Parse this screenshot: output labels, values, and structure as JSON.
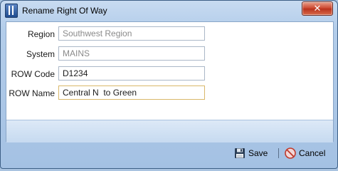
{
  "window": {
    "title": "Rename Right Of Way",
    "close_glyph": "✕",
    "icon": "app-icon"
  },
  "form": {
    "fields": [
      {
        "label": "Region",
        "value": "Southwest Region",
        "readonly": true
      },
      {
        "label": "System",
        "value": "MAINS",
        "readonly": true
      },
      {
        "label": "ROW Code",
        "value": "D1234",
        "readonly": false
      },
      {
        "label": "ROW Name",
        "value": "Central N  to Green",
        "readonly": false
      }
    ]
  },
  "toolbar": {
    "save_label": "Save",
    "cancel_label": "Cancel",
    "save_icon": "floppy-disk-icon",
    "cancel_icon": "cancel-icon"
  },
  "colors": {
    "window_frame": "#a9c3e0",
    "titlebar": "#c8dbf1",
    "close_button": "#c9432b",
    "active_field_border": "#d9b86a"
  }
}
